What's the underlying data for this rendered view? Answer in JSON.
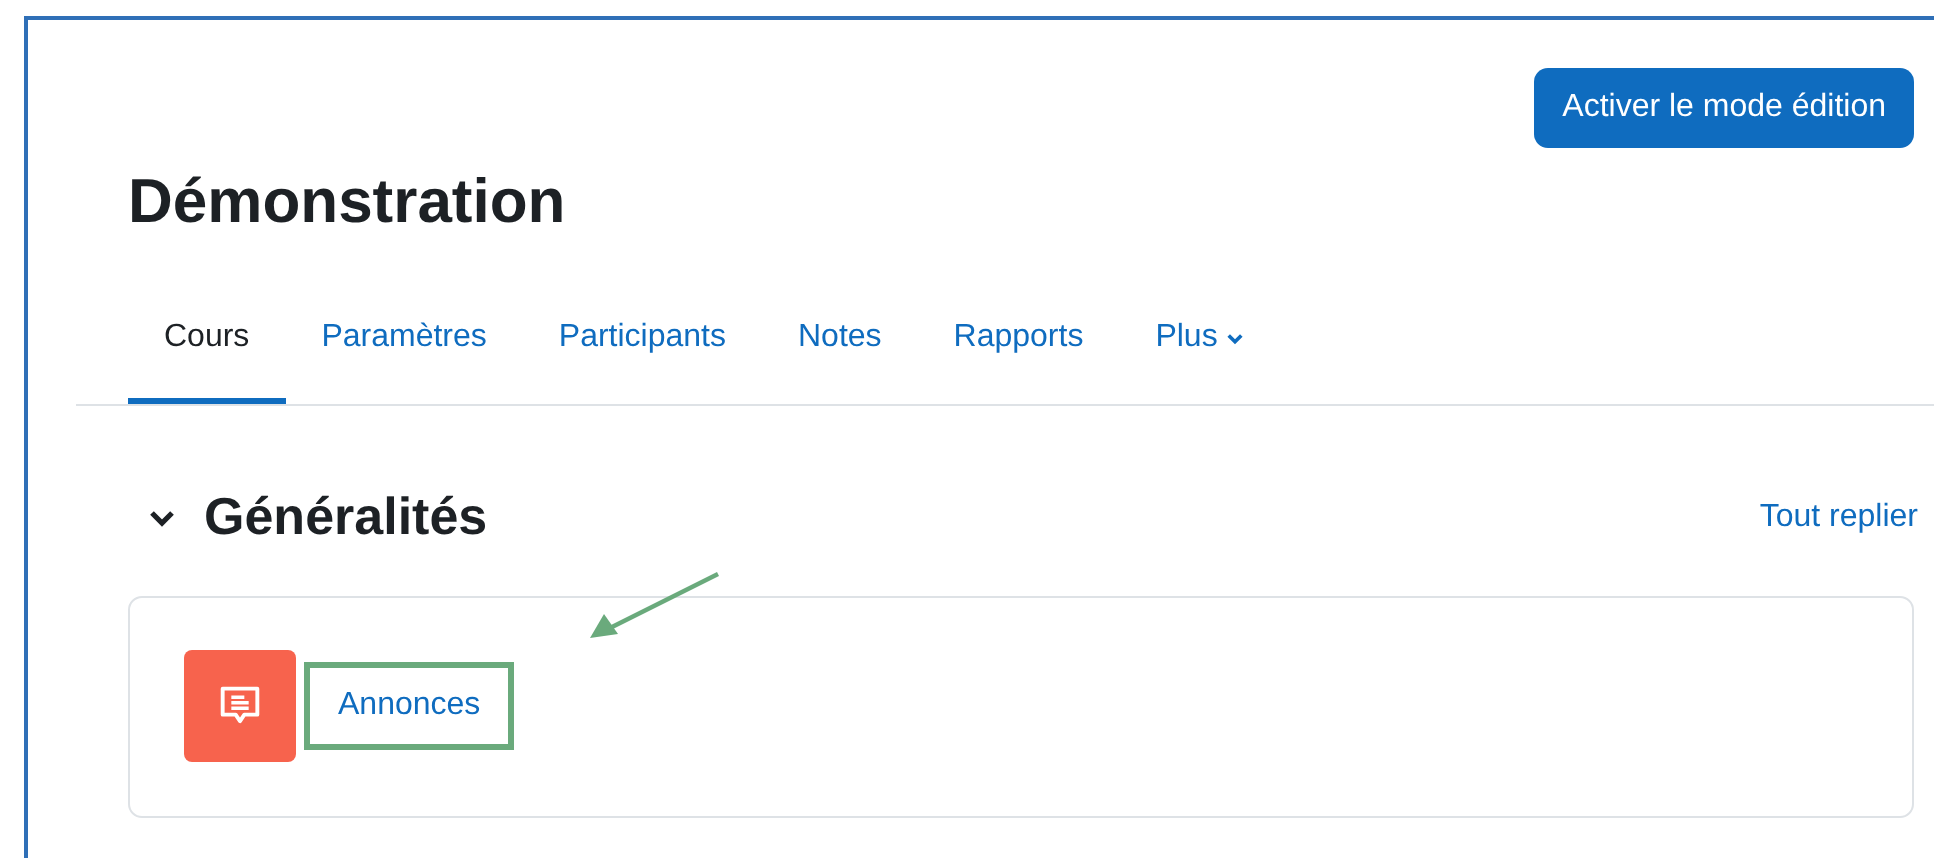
{
  "edit_button": "Activer le mode édition",
  "course_title": "Démonstration",
  "tabs": [
    {
      "label": "Cours",
      "selected": true,
      "dropdown": false
    },
    {
      "label": "Paramètres",
      "selected": false,
      "dropdown": false
    },
    {
      "label": "Participants",
      "selected": false,
      "dropdown": false
    },
    {
      "label": "Notes",
      "selected": false,
      "dropdown": false
    },
    {
      "label": "Rapports",
      "selected": false,
      "dropdown": false
    },
    {
      "label": "Plus",
      "selected": false,
      "dropdown": true
    }
  ],
  "section": {
    "title": "Généralités",
    "expanded": true,
    "collapse_link": "Tout replier",
    "activities": [
      {
        "name": "Annonces",
        "kind": "forum",
        "highlighted": true
      }
    ]
  }
}
